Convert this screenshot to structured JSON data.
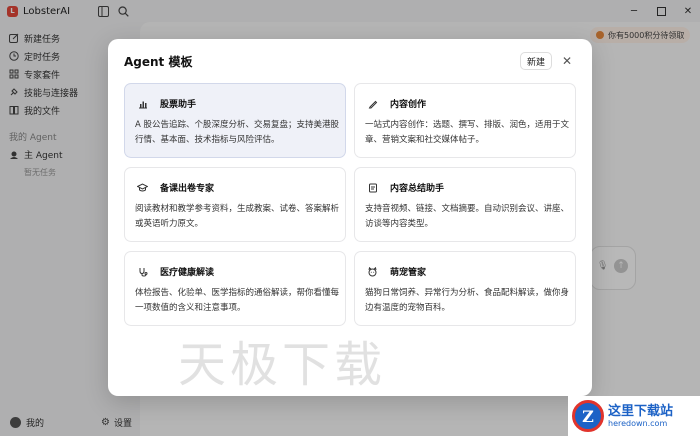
{
  "app": {
    "title": "LobsterAI"
  },
  "sidebar": {
    "items": [
      {
        "label": "新建任务",
        "icon": "new-task-icon"
      },
      {
        "label": "定时任务",
        "icon": "clock-icon"
      },
      {
        "label": "专家套件",
        "icon": "grid-icon"
      },
      {
        "label": "技能与连接器",
        "icon": "plug-icon"
      },
      {
        "label": "我的文件",
        "icon": "book-icon"
      }
    ],
    "agents_section_label": "我的 Agent",
    "main_agent_label": "主 Agent",
    "no_task_label": "暂无任务",
    "me_label": "我的",
    "settings_label": "设置"
  },
  "header": {
    "credits_text": "你有5000积分待领取"
  },
  "modal": {
    "title": "Agent 模板",
    "new_button": "新建",
    "close_icon": "close-icon",
    "cards": [
      {
        "title": "股票助手",
        "icon": "stock-chart-icon",
        "desc": "A 股公告追踪、个股深度分析、交易复盘；支持美港股行情、基本面、技术指标与风险评估。"
      },
      {
        "title": "内容创作",
        "icon": "pen-icon",
        "desc": "一站式内容创作：选题、撰写、排版、润色，适用于文章、营销文案和社交媒体帖子。"
      },
      {
        "title": "备课出卷专家",
        "icon": "graduation-cap-icon",
        "desc": "阅读教材和教学参考资料，生成教案、试卷、答案解析或英语听力原文。"
      },
      {
        "title": "内容总结助手",
        "icon": "document-icon",
        "desc": "支持音视频、链接、文档摘要。自动识别会议、讲座、访谈等内容类型。"
      },
      {
        "title": "医疗健康解读",
        "icon": "stethoscope-icon",
        "desc": "体检报告、化验单、医学指标的通俗解读，帮你看懂每一项数值的含义和注意事项。"
      },
      {
        "title": "萌宠管家",
        "icon": "pet-icon",
        "desc": "猫狗日常饲养、异常行为分析、食品配料解读，做你身边有温度的宠物百科。"
      }
    ]
  },
  "watermark": {
    "text": "天极下载"
  },
  "site_logo": {
    "cn": "这里下载站",
    "en": "heredown.com",
    "badge": "Z"
  }
}
